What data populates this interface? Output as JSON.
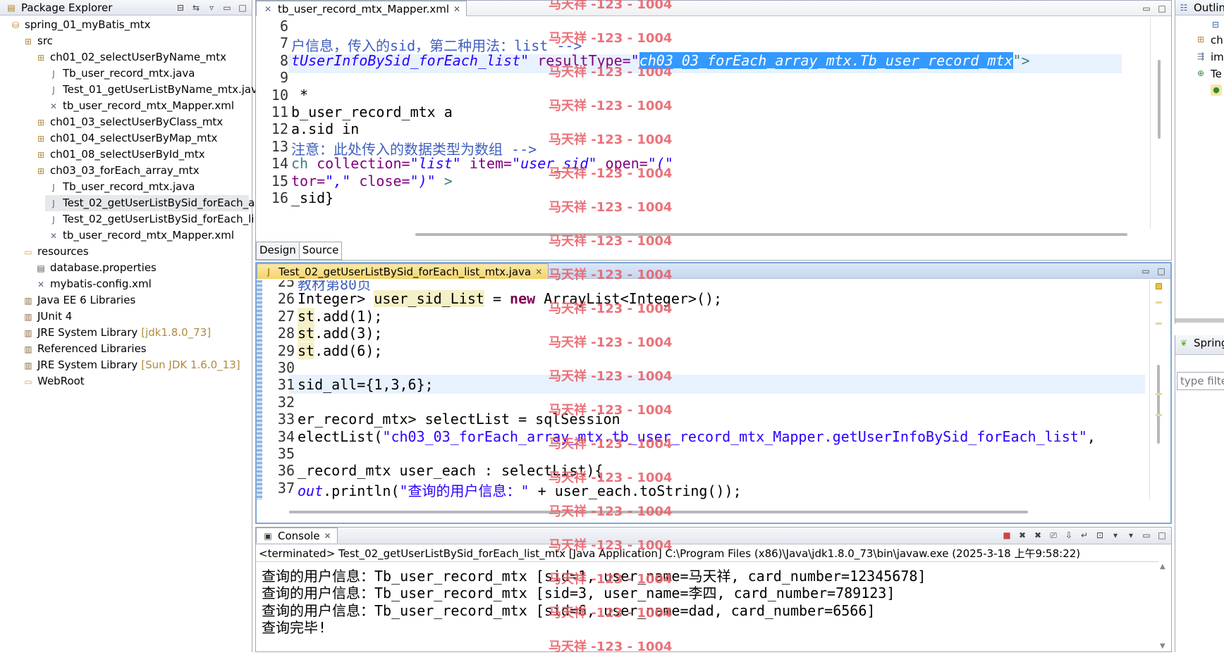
{
  "package_explorer": {
    "title": "Package Explorer",
    "items": [
      {
        "label": "spring_01_myBatis_mtx",
        "icon": "project-icon",
        "level": 0
      },
      {
        "label": "src",
        "icon": "source-folder-icon",
        "level": 1
      },
      {
        "label": "ch01_02_selectUserByName_mtx",
        "icon": "package-icon",
        "level": 2
      },
      {
        "label": "Tb_user_record_mtx.java",
        "icon": "java-file-icon",
        "level": 3
      },
      {
        "label": "Test_01_getUserListByName_mtx.java",
        "icon": "java-file-icon",
        "level": 3
      },
      {
        "label": "tb_user_record_mtx_Mapper.xml",
        "icon": "xml-file-icon",
        "level": 3
      },
      {
        "label": "ch01_03_selectUserByClass_mtx",
        "icon": "package-icon",
        "level": 2
      },
      {
        "label": "ch01_04_selectUserByMap_mtx",
        "icon": "package-icon",
        "level": 2
      },
      {
        "label": "ch01_08_selectUserById_mtx",
        "icon": "package-icon",
        "level": 2
      },
      {
        "label": "ch03_03_forEach_array_mtx",
        "icon": "package-icon",
        "level": 2
      },
      {
        "label": "Tb_user_record_mtx.java",
        "icon": "java-file-icon",
        "level": 3
      },
      {
        "label": "Test_02_getUserListBySid_forEach_a",
        "icon": "java-file-icon",
        "level": 3,
        "selected": true
      },
      {
        "label": "Test_02_getUserListBySid_forEach_li",
        "icon": "java-file-icon",
        "level": 3
      },
      {
        "label": "tb_user_record_mtx_Mapper.xml",
        "icon": "xml-file-icon",
        "level": 3
      },
      {
        "label": "resources",
        "icon": "folder-icon",
        "level": 1
      },
      {
        "label": "database.properties",
        "icon": "properties-file-icon",
        "level": 2
      },
      {
        "label": "mybatis-config.xml",
        "icon": "xml-file-icon",
        "level": 2
      },
      {
        "label": "Java EE 6 Libraries",
        "icon": "library-icon",
        "level": 1
      },
      {
        "label": "JUnit 4",
        "icon": "library-icon",
        "level": 1
      },
      {
        "label": "JRE System Library",
        "deco": "[jdk1.8.0_73]",
        "icon": "library-icon",
        "level": 1
      },
      {
        "label": "Referenced Libraries",
        "icon": "library-icon",
        "level": 1
      },
      {
        "label": "JRE System Library",
        "deco": "[Sun JDK 1.6.0_13]",
        "icon": "library-icon",
        "level": 1
      },
      {
        "label": "WebRoot",
        "icon": "folder-icon",
        "level": 1
      }
    ]
  },
  "xml_editor": {
    "tab": "tb_user_record_mtx_Mapper.xml",
    "bottom_tabs": [
      "Design",
      "Source"
    ],
    "lines": [
      {
        "n": "6",
        "segs": []
      },
      {
        "n": "7",
        "segs": [
          {
            "t": "户信息，传入的sid，第二种用法：list -->",
            "c": "com"
          }
        ]
      },
      {
        "n": "8",
        "segs": [
          {
            "t": "tUserInfoBySid_forEach_list\"",
            "c": "str it"
          },
          {
            "t": " resultType=",
            "c": "attr"
          },
          {
            "t": "\"",
            "c": "str it"
          },
          {
            "t": "ch03_03_forEach_array_mtx.Tb_user_record_mtx",
            "c": "sel"
          },
          {
            "t": "\">",
            "c": "tag"
          }
        ]
      },
      {
        "n": "9",
        "segs": []
      },
      {
        "n": "10",
        "segs": [
          {
            "t": " *",
            "c": ""
          }
        ]
      },
      {
        "n": "11",
        "segs": [
          {
            "t": "b_user_record_mtx a",
            "c": ""
          }
        ]
      },
      {
        "n": "12",
        "segs": [
          {
            "t": "a.sid in",
            "c": ""
          }
        ]
      },
      {
        "n": "13",
        "segs": [
          {
            "t": "注意：此处传入的数据类型为数组 -->",
            "c": "com"
          }
        ]
      },
      {
        "n": "14",
        "segs": [
          {
            "t": "ch ",
            "c": "tag"
          },
          {
            "t": "collection=",
            "c": "attr"
          },
          {
            "t": "\"list\"",
            "c": "str it"
          },
          {
            "t": " item=",
            "c": "attr"
          },
          {
            "t": "\"user_sid\"",
            "c": "str it"
          },
          {
            "t": " open=",
            "c": "attr"
          },
          {
            "t": "\"(\"",
            "c": "str it"
          }
        ]
      },
      {
        "n": "15",
        "segs": [
          {
            "t": "tor=",
            "c": "attr"
          },
          {
            "t": "\",\"",
            "c": "str it"
          },
          {
            "t": " close=",
            "c": "attr"
          },
          {
            "t": "\")\"",
            "c": "str it"
          },
          {
            "t": " >",
            "c": "tag"
          }
        ]
      },
      {
        "n": "16",
        "segs": [
          {
            "t": "_sid}",
            "c": ""
          }
        ]
      }
    ]
  },
  "java_editor": {
    "tab": "Test_02_getUserListBySid_forEach_list_mtx.java",
    "lines": [
      {
        "n": "25",
        "segs": [
          {
            "t": "教材第80页",
            "c": "com"
          }
        ]
      },
      {
        "n": "26",
        "segs": [
          {
            "t": "Integer> ",
            "c": ""
          },
          {
            "t": "user_sid_List",
            "c": "occ"
          },
          {
            "t": " = ",
            "c": ""
          },
          {
            "t": "new",
            "c": "kw"
          },
          {
            "t": " ArrayList<Integer>();",
            "c": ""
          }
        ]
      },
      {
        "n": "27",
        "segs": [
          {
            "t": "st",
            "c": "occ"
          },
          {
            "t": ".add(1);",
            "c": ""
          }
        ]
      },
      {
        "n": "28",
        "segs": [
          {
            "t": "st",
            "c": "occ"
          },
          {
            "t": ".add(3);",
            "c": ""
          }
        ]
      },
      {
        "n": "29",
        "segs": [
          {
            "t": "st",
            "c": "occ"
          },
          {
            "t": ".add(6);",
            "c": ""
          }
        ]
      },
      {
        "n": "30",
        "segs": []
      },
      {
        "n": "31",
        "segs": [
          {
            "t": "sid_all={1,3,6};",
            "c": ""
          }
        ]
      },
      {
        "n": "32",
        "segs": []
      },
      {
        "n": "33",
        "segs": [
          {
            "t": "er_record_mtx> selectList = sqlSession",
            "c": ""
          }
        ]
      },
      {
        "n": "34",
        "segs": [
          {
            "t": "electList(",
            "c": ""
          },
          {
            "t": "\"ch03_03_forEach_array_mtx.tb_user_record_mtx_Mapper.getUserInfoBySid_forEach_list\"",
            "c": "str"
          },
          {
            "t": ",",
            "c": ""
          }
        ]
      },
      {
        "n": "35",
        "segs": []
      },
      {
        "n": "36",
        "segs": [
          {
            "t": "_record_mtx user_each : selectList){",
            "c": ""
          }
        ]
      },
      {
        "n": "37",
        "segs": [
          {
            "t": "out",
            "c": "str it"
          },
          {
            "t": ".println(",
            "c": ""
          },
          {
            "t": "\"查询的用户信息：\"",
            "c": "str"
          },
          {
            "t": " + user_each.toString());",
            "c": ""
          }
        ]
      }
    ]
  },
  "console": {
    "title": "Console",
    "status": "<terminated> Test_02_getUserListBySid_forEach_list_mtx [Java Application] C:\\Program Files (x86)\\Java\\jdk1.8.0_73\\bin\\javaw.exe (2025-3-18 上午9:58:22)",
    "lines": [
      "查询的用户信息：Tb_user_record_mtx [sid=1, user_name=马天祥, card_number=12345678]",
      "查询的用户信息：Tb_user_record_mtx [sid=3, user_name=李四, card_number=789123]",
      "查询的用户信息：Tb_user_record_mtx [sid=6, user_name=dad, card_number=6566]",
      "查询完毕!"
    ]
  },
  "outline": {
    "title": "Outline",
    "items": [
      "ch",
      "im",
      "Te"
    ]
  },
  "spring": {
    "title": "Spring",
    "filter_placeholder": "type filte"
  },
  "watermark": "马天祥 -123 - 1004",
  "colors": {
    "selection": "#3399ff",
    "current_line": "#e8f2fe",
    "occurrence": "#f5f0c8",
    "watermark": "#e8636b"
  }
}
